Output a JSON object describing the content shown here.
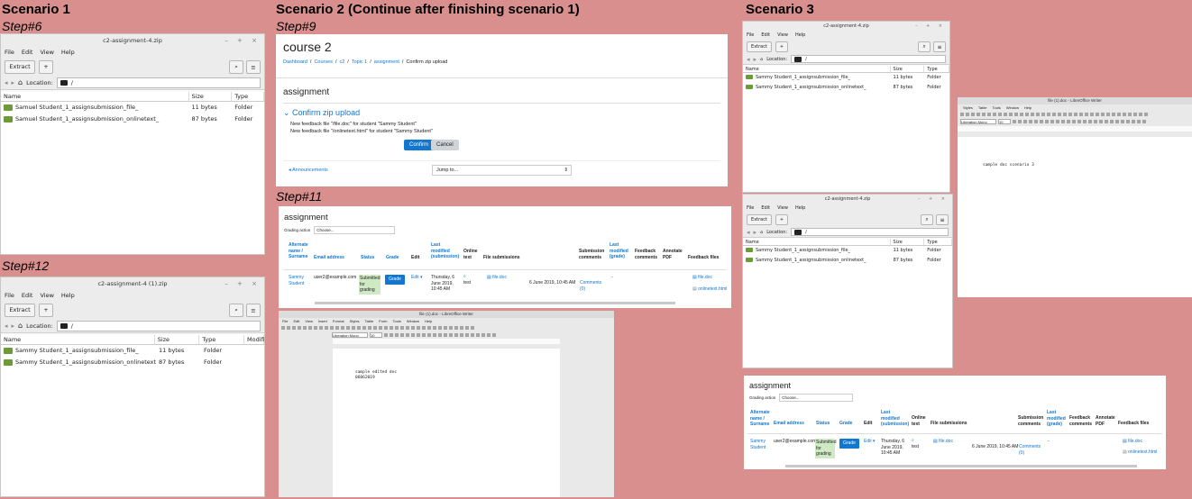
{
  "headings": {
    "s1": "Scenario 1",
    "s2": "Scenario 2 (Continue after finishing scenario 1)",
    "s3": "Scenario 3"
  },
  "steps": {
    "s6": "Step#6",
    "s12": "Step#12",
    "s9": "Step#9",
    "s11": "Step#11"
  },
  "archive_common": {
    "menu": [
      "File",
      "Edit",
      "View",
      "Help"
    ],
    "extract": "Extract",
    "add": "+",
    "location": "Location:",
    "path": "/",
    "headers": [
      "Name",
      "Size",
      "Type",
      "Modifi"
    ]
  },
  "arch1": {
    "title": "c2-assignment-4.zip",
    "rows": [
      {
        "name": "Samuel Student_1_assignsubmission_file_",
        "size": "11 bytes",
        "type": "Folder"
      },
      {
        "name": "Samuel Student_1_assignsubmission_onlinetext_",
        "size": "87 bytes",
        "type": "Folder"
      }
    ]
  },
  "arch2": {
    "title": "c2-assignment-4 (1).zip",
    "rows": [
      {
        "name": "Sammy Student_1_assignsubmission_file_",
        "size": "11 bytes",
        "type": "Folder"
      },
      {
        "name": "Sammy Student_1_assignsubmission_onlinetext_",
        "size": "87 bytes",
        "type": "Folder"
      }
    ]
  },
  "arch3": {
    "title": "c2-assignment-4.zip",
    "rows": [
      {
        "name": "Sammy Student_1_assignsubmission_file_",
        "size": "11 bytes",
        "type": "Folder"
      },
      {
        "name": "Sammy Student_1_assignsubmission_onlinetext_",
        "size": "87 bytes",
        "type": "Folder"
      }
    ]
  },
  "arch4": {
    "title": "c2-assignment-4.zip",
    "rows": [
      {
        "name": "Sammy Student_1_assignsubmission_file_",
        "size": "11 bytes",
        "type": "Folder"
      },
      {
        "name": "Sammy Student_1_assignsubmission_onlinetext_",
        "size": "87 bytes",
        "type": "Folder"
      }
    ]
  },
  "confirm": {
    "course": "course 2",
    "breadcrumb": [
      "Dashboard",
      "Courses",
      "c2",
      "Topic 1",
      "assignment",
      "Confirm zip upload"
    ],
    "assignment": "assignment",
    "section": "Confirm zip upload",
    "line1": "New feedback file \"/file.doc\" for student \"Sammy Student\"",
    "line2": "New feedback file \"/onlinetext.html\" for student \"Sammy Student\"",
    "confirm": "Confirm",
    "cancel": "Cancel",
    "announcements": "◂ Announcements",
    "jump": "Jump to..."
  },
  "grading": {
    "title": "assignment",
    "action_label": "Grading action",
    "action_value": "Choose...",
    "headers": {
      "alt": "Alternate name / Surname",
      "email": "Email address",
      "status": "Status",
      "grade": "Grade",
      "edit": "Edit",
      "lastmod": "Last modified (submission)",
      "online": "Online text",
      "files": "File submissions",
      "subcom": "Submission comments",
      "lastgrade": "Last modified (grade)",
      "fbcom": "Feedback comments",
      "annot": "Annotate PDF",
      "fbfiles": "Feedback files"
    },
    "row": {
      "name": "Sammy Student",
      "email": "user2@example.com",
      "status": "Submitted for grading",
      "grade": "Grade",
      "edit": "Edit ▾",
      "date": "Thursday, 6 June 2019, 10:45 AM",
      "online": "test",
      "file": "file.doc",
      "subdate": "6 June 2019, 10:45 AM",
      "comments": "Comments (0)",
      "dash": "-",
      "fb1": "file.doc",
      "fb2": "onlinetext.html"
    }
  },
  "writer1": {
    "title": "file (1).doc - LibreOffice Writer",
    "font": "Liberation Mono",
    "size": "10",
    "menu": [
      "File",
      "Edit",
      "View",
      "Insert",
      "Format",
      "Styles",
      "Table",
      "Form",
      "Tools",
      "Window",
      "Help"
    ],
    "text1": "sample edited doc",
    "text2": "06062019"
  },
  "writer2": {
    "title": "file (1).doc - LibreOffice Writer",
    "font": "Liberation Mono",
    "size": "10",
    "menu": [
      "Styles",
      "Table",
      "Tools",
      "Window",
      "Help"
    ],
    "text1": "sample doc scenario 3"
  }
}
